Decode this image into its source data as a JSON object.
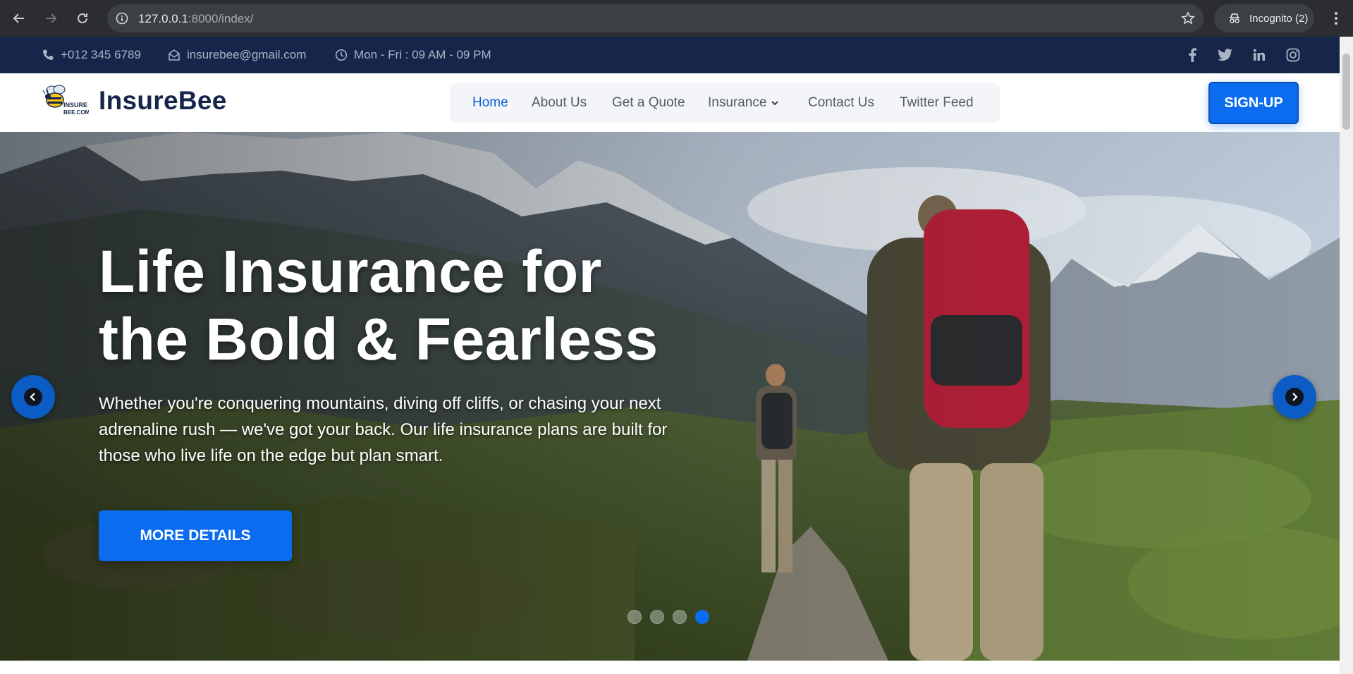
{
  "browser": {
    "url_host": "127.0.0.1",
    "url_rest": ":8000/index/",
    "incognito_label": "Incognito (2)"
  },
  "topbar": {
    "phone": "+012 345 6789",
    "email": "insurebee@gmail.com",
    "hours": "Mon - Fri : 09 AM - 09 PM",
    "social_icons": [
      "facebook-icon",
      "twitter-icon",
      "linkedin-icon",
      "instagram-icon"
    ]
  },
  "header": {
    "logo_text_line1": "INSURE",
    "logo_text_line2": "BEE.COM",
    "brand": "InsureBee",
    "nav": {
      "home": "Home",
      "about": "About Us",
      "quote": "Get a Quote",
      "insurance": "Insurance",
      "contact": "Contact Us",
      "twitter": "Twitter Feed"
    },
    "signup_label": "SIGN-UP"
  },
  "hero": {
    "title_line1": "Life Insurance for",
    "title_line2": "the Bold & Fearless",
    "subtitle": "Whether you're conquering mountains, diving off cliffs, or chasing your next adrenaline rush — we've got your back. Our life insurance plans are built for those who live life on the edge but plan smart.",
    "button_label": "MORE DETAILS",
    "slides_total": 4,
    "active_slide": 4
  },
  "colors": {
    "topbar_bg": "#15264a",
    "accent": "#0b6cf0",
    "brand_text": "#15264a",
    "nav_active": "#0b63d6"
  }
}
